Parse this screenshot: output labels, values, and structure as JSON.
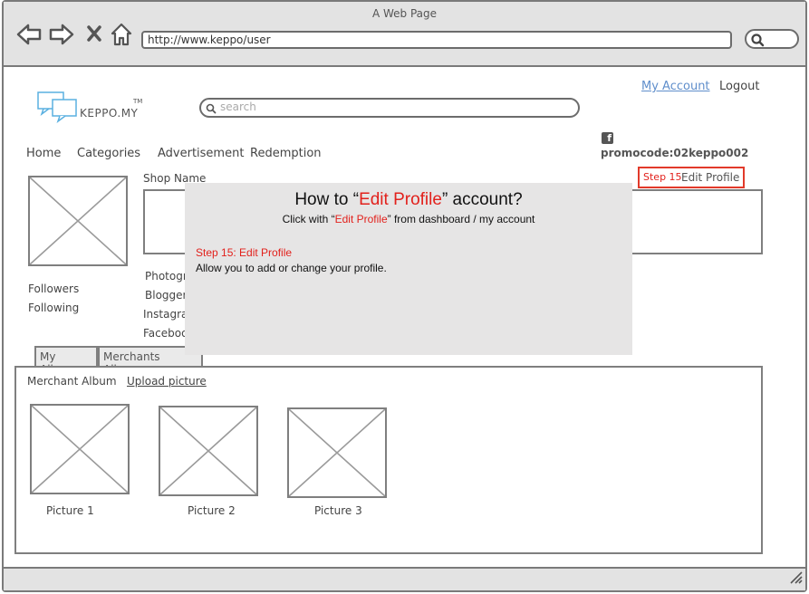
{
  "window": {
    "title": "A Web Page"
  },
  "browser": {
    "url": "http://www.keppo/user"
  },
  "site": {
    "logo_text": "KEPPO.MY",
    "logo_tm": "TM",
    "search_placeholder": "search",
    "account_link": "My Account",
    "logout_link": "Logout",
    "promocode": "promocode:02keppo002"
  },
  "nav": {
    "items": [
      {
        "label": "Home"
      },
      {
        "label": "Categories"
      },
      {
        "label": "Advertisement"
      },
      {
        "label": "Redemption"
      }
    ]
  },
  "profile": {
    "shop_name_label": "Shop Name",
    "followers_label": "Followers",
    "following_label": "Following",
    "links": [
      {
        "label": "Photogr"
      },
      {
        "label": "Blogger"
      },
      {
        "label": "Instagra"
      },
      {
        "label": "Faceboo"
      }
    ],
    "edit_step": "Step 15",
    "edit_label": "Edit Profile"
  },
  "tabs": [
    {
      "label": "My Album"
    },
    {
      "label": "Merchants Album"
    }
  ],
  "album": {
    "title": "Merchant Album",
    "upload_link": "Upload picture",
    "pictures": [
      {
        "caption": "Picture 1"
      },
      {
        "caption": "Picture 2"
      },
      {
        "caption": "Picture 3"
      }
    ]
  },
  "overlay": {
    "title_pre": "How to  “",
    "title_highlight": "Edit Profile",
    "title_post": "” account?",
    "sub_pre": "Click with “",
    "sub_highlight": "Edit Profile",
    "sub_post": "”  from  dashboard / my account",
    "step_title": "Step 15: Edit Profile",
    "step_desc": "Allow you to  add or change your profile."
  },
  "colors": {
    "accent_red": "#e2211c",
    "link_blue": "#5f8ecb",
    "chrome_gray": "#e3e3e3",
    "overlay_gray": "#e6e5e5"
  },
  "icons": [
    "back-arrow-icon",
    "forward-arrow-icon",
    "close-icon",
    "home-icon",
    "search-icon",
    "logo-chat-icon",
    "facebook-icon",
    "resize-grip-icon"
  ]
}
